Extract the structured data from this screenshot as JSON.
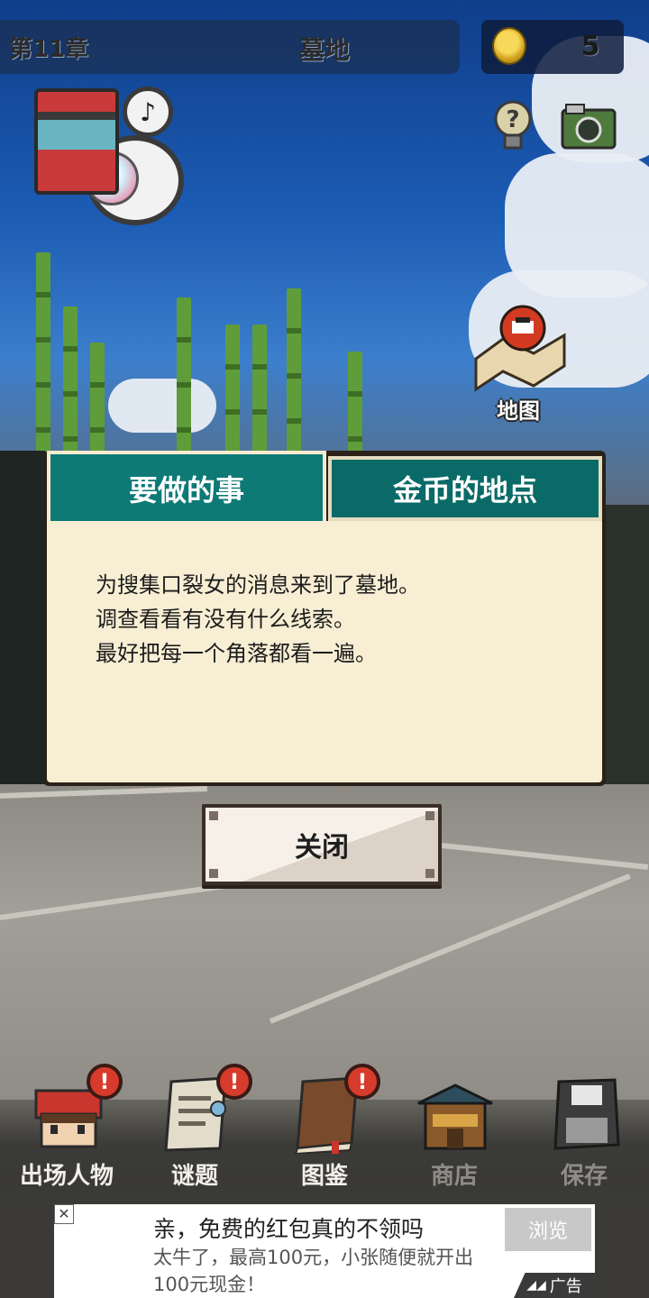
{
  "header": {
    "chapter": "第11章",
    "location": "墓地",
    "coins": "5"
  },
  "map": {
    "label": "地图"
  },
  "dialog": {
    "tabs": [
      {
        "label": "要做的事",
        "active": true
      },
      {
        "label": "金币的地点",
        "active": false
      }
    ],
    "lines": [
      "为搜集口裂女的消息来到了墓地。",
      "调查看看有没有什么线索。",
      "最好把每一个角落都看一遍。"
    ],
    "close_label": "关闭"
  },
  "toolbar": {
    "items": [
      {
        "label": "出场人物",
        "icon": "character-icon",
        "alert": true
      },
      {
        "label": "谜题",
        "icon": "puzzle-scroll-icon",
        "alert": true
      },
      {
        "label": "图鉴",
        "icon": "book-icon",
        "alert": true
      },
      {
        "label": "商店",
        "icon": "shop-icon",
        "alert": false
      },
      {
        "label": "保存",
        "icon": "floppy-disk-icon",
        "alert": false
      }
    ],
    "alert_symbol": "!"
  },
  "ad": {
    "close_symbol": "✕",
    "title": "亲，免费的红包真的不领吗",
    "description": "太牛了，最高100元，小张随便就开出100元现金！",
    "browse_label": "浏览",
    "tag": "广告"
  },
  "colors": {
    "tab_teal": "#0d7a76",
    "dialog_bg": "#f7eed4",
    "alert_red": "#d63b2c"
  }
}
